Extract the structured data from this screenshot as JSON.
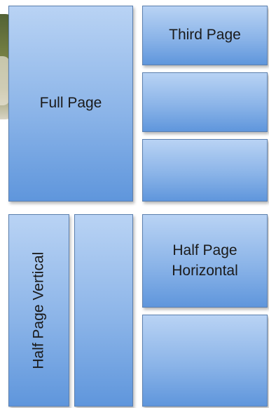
{
  "layouts": {
    "full_page": {
      "label": "Full Page"
    },
    "third_page": {
      "label": "Third Page"
    },
    "half_page_vertical": {
      "label": "Half Page Vertical"
    },
    "half_page_horizontal": {
      "label": "Half Page Horizontal"
    }
  },
  "colors": {
    "box_light": "#b9d3f4",
    "box_dark": "#5f96dc",
    "border": "#5b7fae"
  }
}
